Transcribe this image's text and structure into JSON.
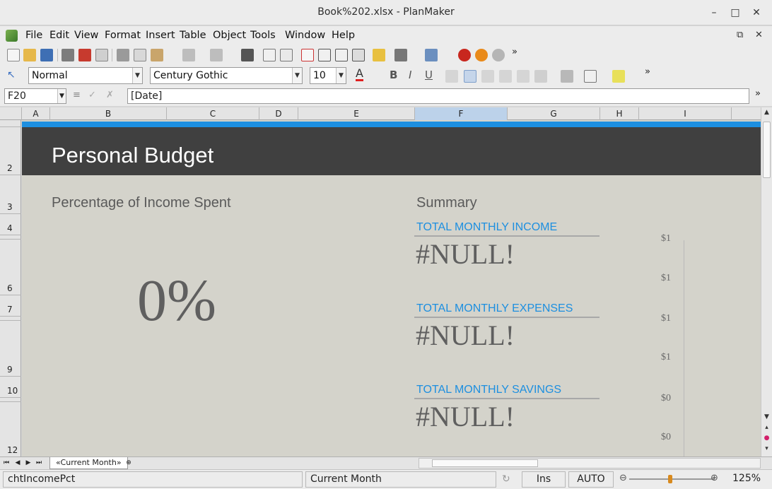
{
  "window": {
    "title": "Book%202.xlsx - PlanMaker"
  },
  "menu": [
    "File",
    "Edit",
    "View",
    "Format",
    "Insert",
    "Table",
    "Object",
    "Tools",
    "Window",
    "Help"
  ],
  "format_bar": {
    "style": "Normal",
    "font": "Century Gothic",
    "size": "10"
  },
  "formula_bar": {
    "cell_ref": "F20",
    "content": "[Date]"
  },
  "columns": [
    "A",
    "B",
    "C",
    "D",
    "E",
    "F",
    "G",
    "H",
    "I"
  ],
  "selected_column": "F",
  "rows": [
    "2",
    "3",
    "4",
    "6",
    "7",
    "9",
    "10",
    "12"
  ],
  "sheet": {
    "title": "Personal Budget",
    "income_spent_title": "Percentage of Income Spent",
    "income_spent_value": "0%",
    "summary_title": "Summary",
    "metrics": [
      {
        "label": "TOTAL MONTHLY INCOME",
        "value": "#NULL!"
      },
      {
        "label": "TOTAL MONTHLY EXPENSES",
        "value": "#NULL!"
      },
      {
        "label": "TOTAL MONTHLY SAVINGS",
        "value": "#NULL!"
      }
    ],
    "axis_labels": [
      "$1",
      "$1",
      "$1",
      "$1",
      "$0",
      "$0"
    ]
  },
  "tabs": {
    "active": "«Current Month»"
  },
  "status": {
    "object_name": "chtIncomePct",
    "sheet_name": "Current Month",
    "insert_mode": "Ins",
    "calc_mode": "AUTO",
    "zoom": "125%"
  },
  "colors": {
    "accent": "#1d8fe0",
    "banner": "#404040",
    "sheet_bg": "#d4d3cb"
  }
}
